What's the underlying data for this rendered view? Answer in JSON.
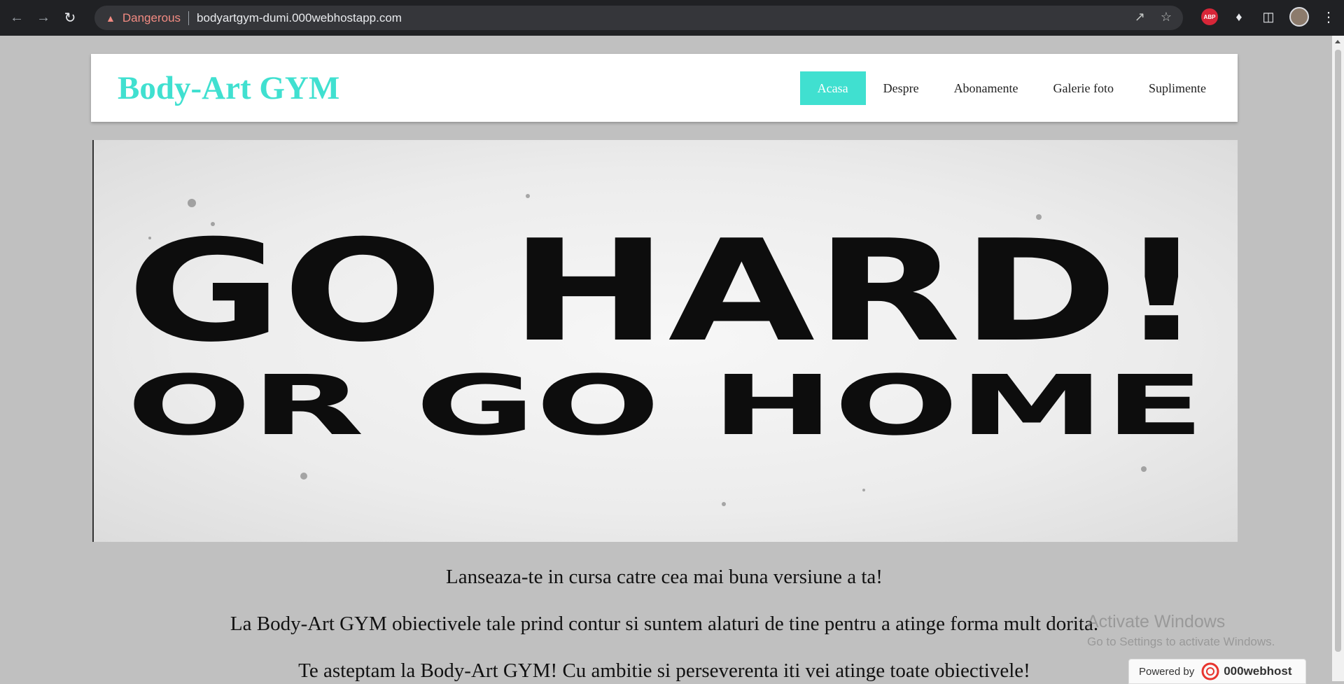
{
  "browser": {
    "security_label": "Dangerous",
    "url": "bodyartgym-dumi.000webhostapp.com",
    "abp_label": "ABP"
  },
  "header": {
    "logo": "Body-Art GYM",
    "menu": [
      {
        "label": "Acasa",
        "active": true
      },
      {
        "label": "Despre",
        "active": false
      },
      {
        "label": "Abonamente",
        "active": false
      },
      {
        "label": "Galerie foto",
        "active": false
      },
      {
        "label": "Suplimente",
        "active": false
      }
    ]
  },
  "hero": {
    "line1": "GO HARD!",
    "line2": "OR GO HOME"
  },
  "content": {
    "p1": "Lanseaza-te in cursa catre cea mai buna versiune a ta!",
    "p2": "La Body-Art GYM obiectivele tale prind contur si suntem alaturi de tine pentru a atinge forma mult dorita.",
    "p3": "Te asteptam la Body-Art GYM! Cu ambitie si perseverenta iti vei atinge toate obiectivele!"
  },
  "watermark": {
    "title": "Activate Windows",
    "subtitle": "Go to Settings to activate Windows."
  },
  "powered_by": {
    "label": "Powered by",
    "brand": "000webhost"
  },
  "colors": {
    "accent": "#40e0d0",
    "page_bg": "#c0c0c0",
    "chrome_bg": "#202124",
    "danger": "#f28b82"
  }
}
